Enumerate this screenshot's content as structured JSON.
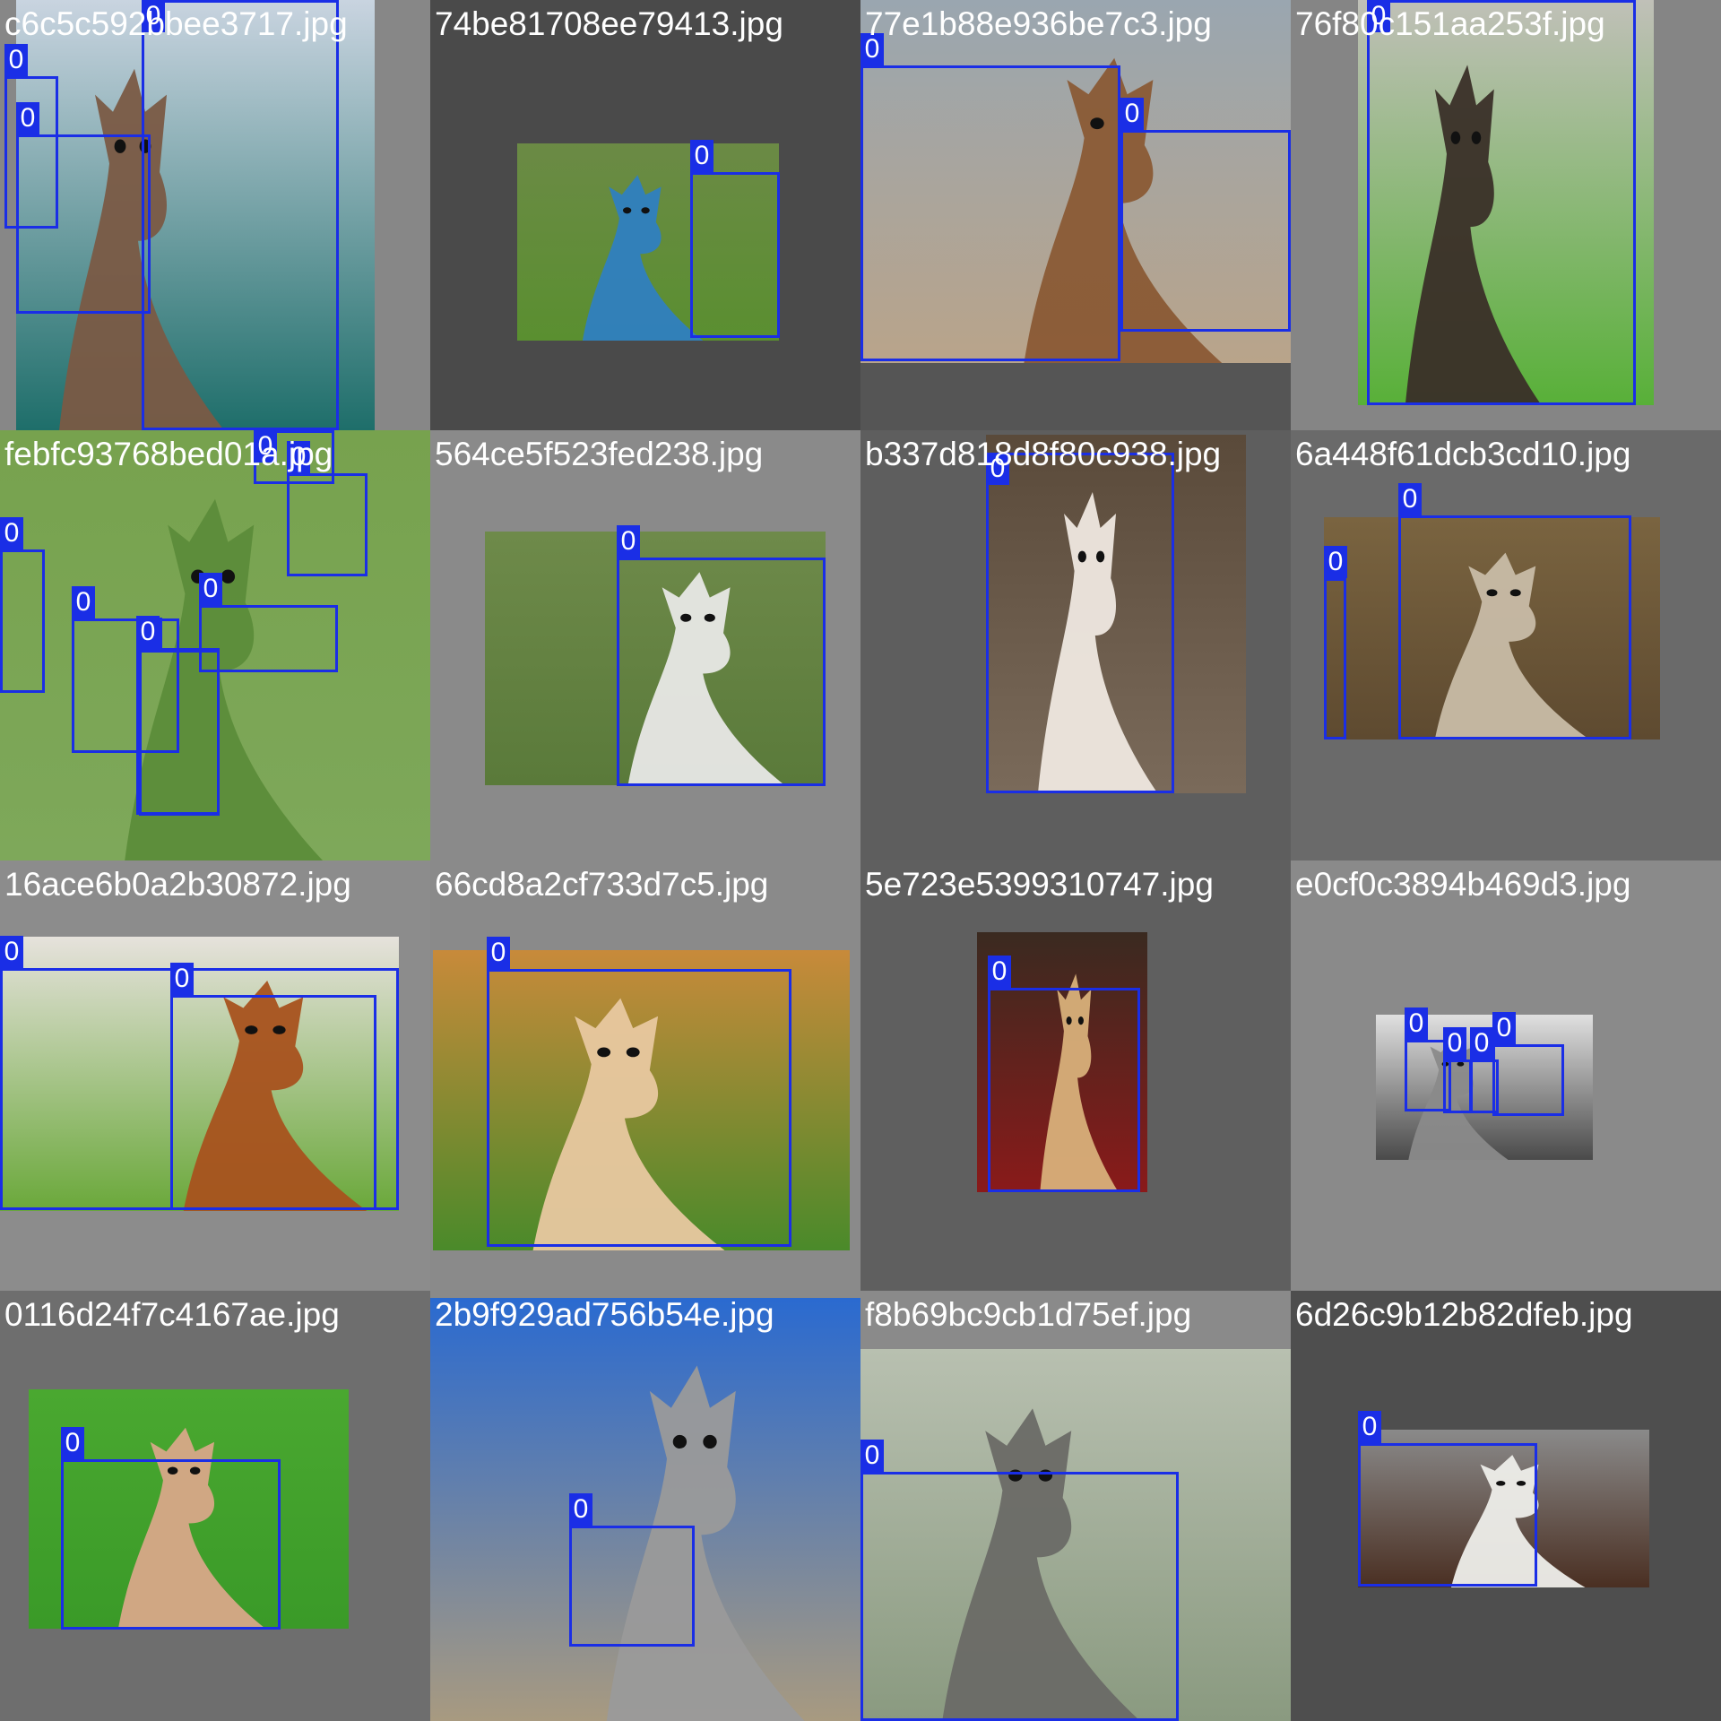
{
  "colors": {
    "box": "#1a2ee6",
    "label_text": "#ffffff",
    "filename_text": "#ffffff"
  },
  "tiles": [
    {
      "filename": "c6c5c592bbee3717.jpg",
      "bg": "#878787",
      "photo": [
        "#c9d4e0",
        "#7a5a44",
        "#1e6e6a"
      ],
      "boxes": [
        {
          "cls": "0"
        },
        {
          "cls": "0"
        },
        {
          "cls": "0"
        }
      ]
    },
    {
      "filename": "74be81708ee79413.jpg",
      "bg": "#4a4a4a",
      "photo": [
        "#6b8a45",
        "#2f7fc0",
        "#5a8f30"
      ],
      "boxes": [
        {
          "cls": "0"
        }
      ]
    },
    {
      "filename": "77e1b88e936be7c3.jpg",
      "bg": "#555555",
      "photo": [
        "#9aa6b0",
        "#8a5a35",
        "#b9a48a"
      ],
      "boxes": [
        {
          "cls": "0"
        },
        {
          "cls": "0"
        }
      ]
    },
    {
      "filename": "76f80c151aa253f.jpg",
      "bg": "#858585",
      "photo": [
        "#c0c0b8",
        "#3a2f28",
        "#58b038"
      ],
      "boxes": [
        {
          "cls": "0"
        }
      ]
    },
    {
      "filename": "febfc93768bed01a.jpg",
      "bg": "#6a8f45",
      "photo": [
        "#77a24e",
        "#5c8c3a",
        "#7ea85a"
      ],
      "boxes": [
        {
          "cls": "0"
        },
        {
          "cls": "0"
        },
        {
          "cls": "0"
        },
        {
          "cls": "0"
        },
        {
          "cls": "0"
        },
        {
          "cls": "0"
        },
        {
          "cls": "0"
        }
      ]
    },
    {
      "filename": "564ce5f523fed238.jpg",
      "bg": "#8a8a8a",
      "photo": [
        "#6e8a4a",
        "#e8e8e6",
        "#5a7a3a"
      ],
      "boxes": [
        {
          "cls": "0"
        }
      ]
    },
    {
      "filename": "b337d818d8f80c938.jpg",
      "bg": "#5e5e5e",
      "photo": [
        "#5a4a3a",
        "#efe8e0",
        "#7a6a5a"
      ],
      "boxes": [
        {
          "cls": "0"
        }
      ]
    },
    {
      "filename": "6a448f61dcb3cd10.jpg",
      "bg": "#6a6a6a",
      "photo": [
        "#7a6440",
        "#c8bca6",
        "#5e4a30"
      ],
      "boxes": [
        {
          "cls": "0"
        },
        {
          "cls": "0"
        }
      ]
    },
    {
      "filename": "16ace6b0a2b30872.jpg",
      "bg": "#8c8c8c",
      "photo": [
        "#e6e2dc",
        "#a8521e",
        "#6aa83a"
      ],
      "boxes": [
        {
          "cls": "0"
        },
        {
          "cls": "0"
        }
      ]
    },
    {
      "filename": "66cd8a2cf733d7c5.jpg",
      "bg": "#8a8a8a",
      "photo": [
        "#c88a3a",
        "#e8c8a0",
        "#4a8a2a"
      ],
      "boxes": [
        {
          "cls": "0"
        }
      ]
    },
    {
      "filename": "5e723e5399310747.jpg",
      "bg": "#5f5f5f",
      "photo": [
        "#3a2a20",
        "#d8b07a",
        "#8a1a1a"
      ],
      "boxes": [
        {
          "cls": "0"
        }
      ]
    },
    {
      "filename": "e0cf0c3894b469d3.jpg",
      "bg": "#8a8a8a",
      "photo": [
        "#e0e0e0",
        "#8a8a8a",
        "#4a4a4a"
      ],
      "boxes": [
        {
          "cls": "0"
        },
        {
          "cls": "0"
        },
        {
          "cls": "0"
        },
        {
          "cls": "0"
        }
      ]
    },
    {
      "filename": "0116d24f7c4167ae.jpg",
      "bg": "#6e6e6e",
      "photo": [
        "#4aa830",
        "#d8a888",
        "#3a9a28"
      ],
      "boxes": [
        {
          "cls": "0"
        }
      ]
    },
    {
      "filename": "2b9f929ad756b54e.jpg",
      "bg": "#8a8a8a",
      "photo": [
        "#2a6ad0",
        "#9a9a9a",
        "#a89a80"
      ],
      "boxes": [
        {
          "cls": "0"
        }
      ]
    },
    {
      "filename": "f8b69bc9cb1d75ef.jpg",
      "bg": "#8a8a8a",
      "photo": [
        "#b8c0b0",
        "#6a6a66",
        "#8a9a80"
      ],
      "boxes": [
        {
          "cls": "0"
        }
      ]
    },
    {
      "filename": "6d26c9b12b82dfeb.jpg",
      "bg": "#4e4e4e",
      "photo": [
        "#8a8a8a",
        "#eeeeea",
        "#4a2f22"
      ],
      "boxes": [
        {
          "cls": "0"
        }
      ]
    }
  ]
}
